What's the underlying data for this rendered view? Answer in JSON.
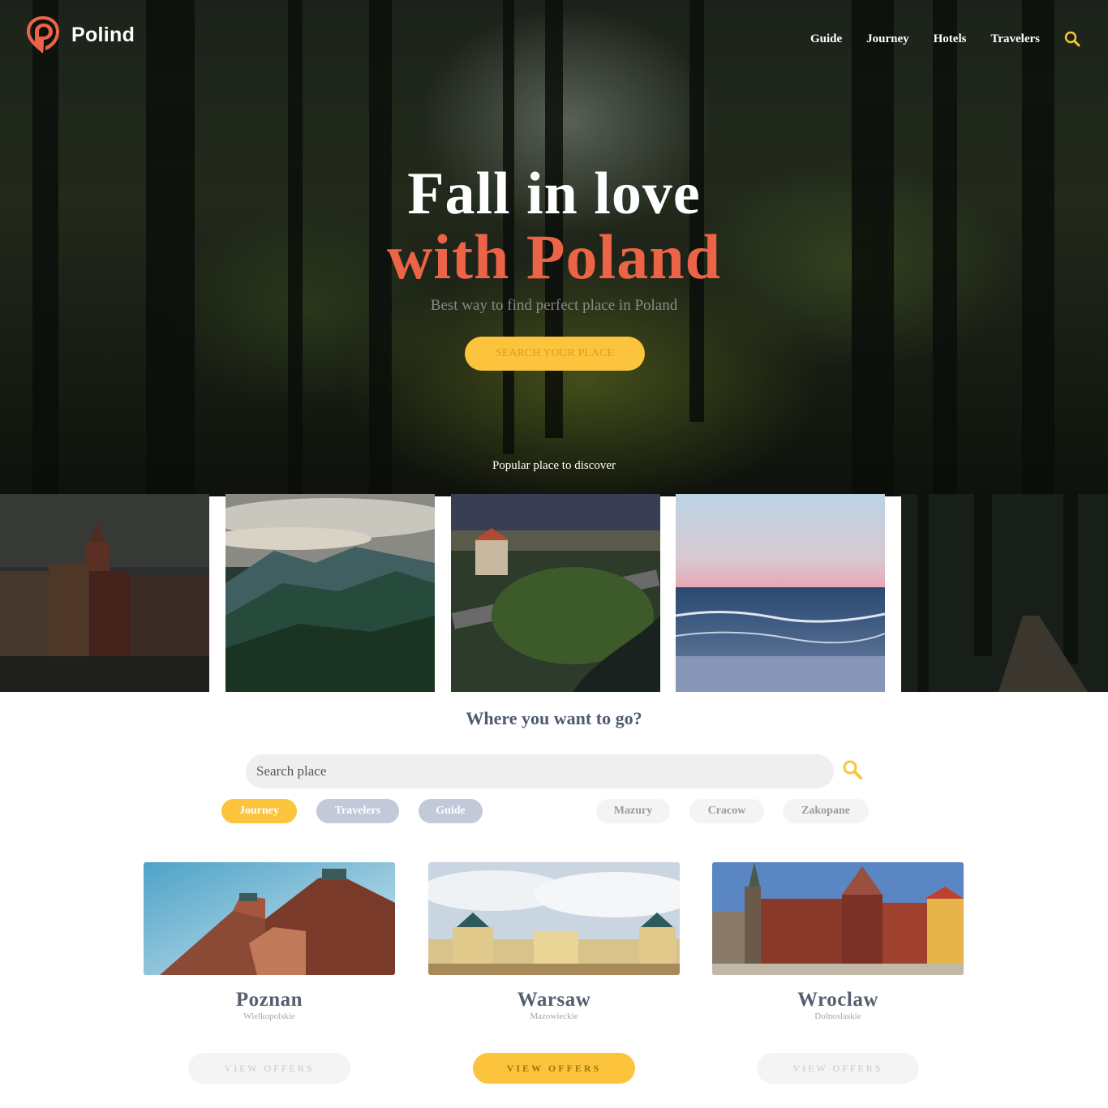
{
  "brand": {
    "name": "Polind",
    "accent": "#ec6448",
    "yellow": "#fbc43c"
  },
  "nav": {
    "links": [
      "Guide",
      "Journey",
      "Hotels",
      "Travelers"
    ],
    "search_icon": "search-icon"
  },
  "hero": {
    "title_line1": "Fall in love",
    "title_line2": "with Poland",
    "subtitle": "Best way to find perfect place in Poland",
    "cta": "SEARCH YOUR PLACE",
    "popular_label": "Popular place to discover"
  },
  "gallery": {
    "tiles": [
      "old-town-photo",
      "mountains-photo",
      "castle-river-photo",
      "sea-photo",
      "forest-path-photo"
    ]
  },
  "search": {
    "heading": "Where you want to go?",
    "placeholder": "Search place",
    "categories": [
      "Journey",
      "Travelers",
      "Guide"
    ],
    "places": [
      "Mazury",
      "Cracow",
      "Zakopane"
    ]
  },
  "cities": [
    {
      "name": "Poznan",
      "region": "Wielkopolskie",
      "button": "VIEW OFFERS",
      "active": false
    },
    {
      "name": "Warsaw",
      "region": "Mazowieckie",
      "button": "VIEW OFFERS",
      "active": true
    },
    {
      "name": "Wroclaw",
      "region": "Dolnoslaskie",
      "button": "VIEW OFFERS",
      "active": false
    }
  ]
}
